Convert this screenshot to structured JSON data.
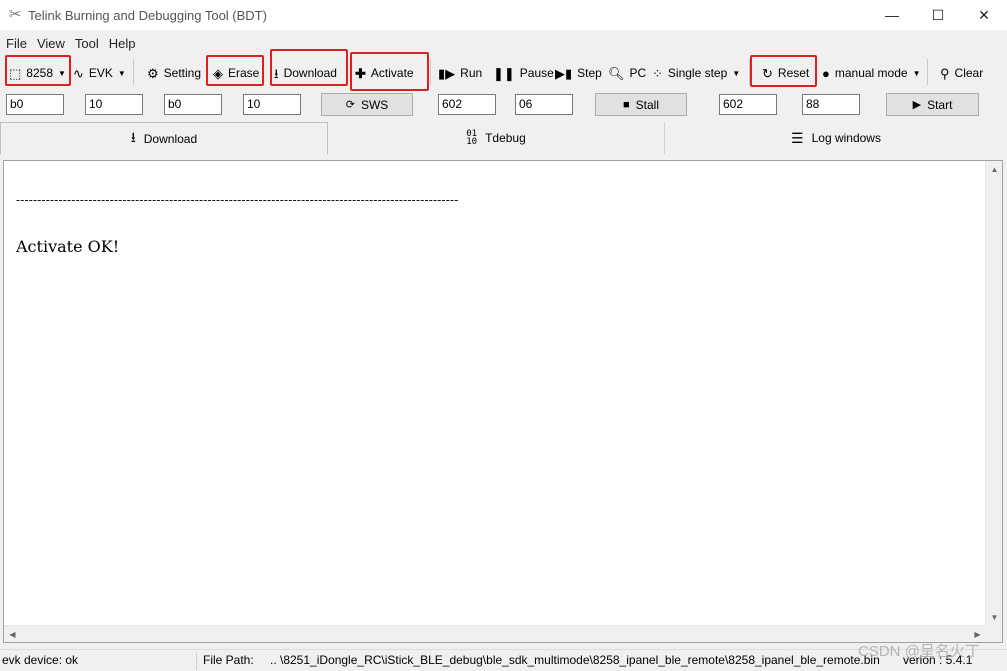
{
  "window": {
    "title": "Telink Burning and Debugging Tool (BDT)",
    "minimize": "—",
    "maximize": "☐",
    "close": "✕"
  },
  "menu": [
    "File",
    "View",
    "Tool",
    "Help"
  ],
  "toolbar": {
    "chip": "8258",
    "evk": "EVK",
    "setting": "Setting",
    "erase": "Erase",
    "download": "Download",
    "activate": "Activate",
    "run": "Run",
    "pause": "Pause",
    "step": "Step",
    "pc": "PC",
    "single_step": "Single step",
    "reset": "Reset",
    "manual_mode": "manual mode",
    "clear": "Clear"
  },
  "inputs": {
    "field1": "b0",
    "field2": "10",
    "field3": "b0",
    "field4": "10",
    "sws_button": "SWS",
    "field5": "602",
    "field6": "06",
    "stall_button": "Stall",
    "field7": "602",
    "field8": "88",
    "start_button": "Start"
  },
  "tabs": {
    "download": "Download",
    "tdebug": "Tdebug",
    "log_windows": "Log windows"
  },
  "log": {
    "separator": "--------------------------------------------------------------------------------------------------------",
    "message": "Activate OK!"
  },
  "status": {
    "device": "evk device: ok",
    "file_path_label": "File Path:",
    "file_path": "..  \\8251_iDongle_RC\\iStick_BLE_debug\\ble_sdk_multimode\\8258_ipanel_ble_remote\\8258_ipanel_ble_remote.bin",
    "version": "verion : 5.4.1"
  },
  "watermark": "CSDN @呈名火丁",
  "colors": {
    "highlight_box": "#e02020",
    "window_bg": "#f0f0f0"
  }
}
